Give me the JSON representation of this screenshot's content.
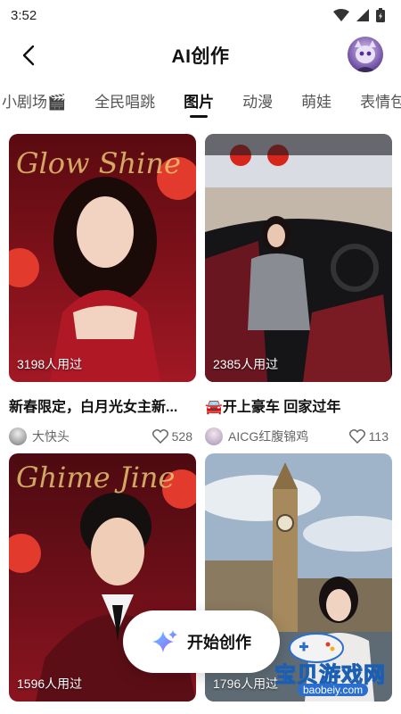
{
  "status": {
    "time": "3:52"
  },
  "header": {
    "title": "AI创作"
  },
  "tabs": [
    "小剧场🎬",
    "全民唱跳",
    "图片",
    "动漫",
    "萌娃",
    "表情包"
  ],
  "cards": [
    {
      "count": "3198人用过",
      "title": "新春限定，白月光女主新...",
      "author": "大快头",
      "likes": "528",
      "overlay_text": "Glow Shine"
    },
    {
      "count": "2385人用过",
      "title": "🚘开上豪车 回家过年",
      "author": "AICG红腹锦鸡",
      "likes": "113"
    },
    {
      "count": "1596人用过",
      "overlay_text": "Ghime Jine"
    },
    {
      "count": "1796人用过"
    }
  ],
  "create_button": {
    "label": "开始创作"
  },
  "watermark": {
    "text": "宝贝游戏网",
    "url": "baobeiy.com"
  },
  "colors": {
    "accent": "#111111",
    "muted": "#666666",
    "red": "#9e1220"
  }
}
